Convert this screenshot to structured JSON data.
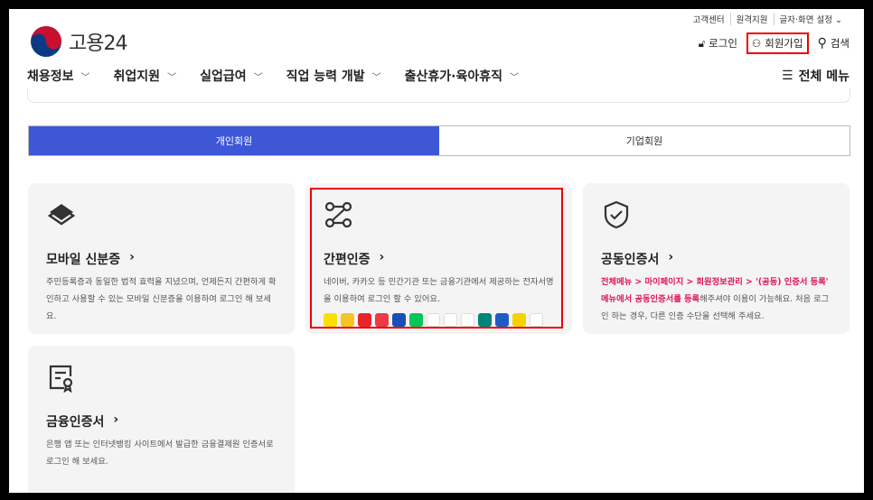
{
  "util_links": [
    "고객센터",
    "원격지원",
    "글자·화면 설정 ⌄"
  ],
  "logo": {
    "text": "고용24"
  },
  "actions": {
    "login": "로그인",
    "join": "회원가입",
    "search": "검색"
  },
  "gnb": [
    "채용정보",
    "취업지원",
    "실업급여",
    "직업 능력 개발",
    "출산휴가·육아휴직"
  ],
  "all_menu": "전체 메뉴",
  "tabs": {
    "personal": "개인회원",
    "corporate": "기업회원",
    "active": "개인회원"
  },
  "cards": {
    "mobile": {
      "title": "모바일 신분증",
      "desc": "주민등록증과 동일한 법적 효력을 지녔으며, 언제든지 간편하게 확인하고 사용할 수 있는 모바일 신분증을 이용하여 로그인 해 보세요."
    },
    "simple": {
      "title": "간편인증",
      "desc": "네이버, 카카오 등 민간기관 또는 금융기관에서 제공하는 전자서명을 이용하여 로그인 할 수 있어요."
    },
    "joint": {
      "title": "공동인증서",
      "desc_highlight": "전체메뉴 > 마이페이지 > 회원정보관리 > '(공동) 인증서 등록' 메뉴에서 공동인증서를 등록",
      "desc": "해주셔야 이용이 가능해요. 처음 로그인 하는 경우, 다른 인증 수단을 선택해 주세요."
    },
    "finance": {
      "title": "금융인증서",
      "desc": "은행 앱 또는 인터넷뱅킹 사이트에서 발급한 금융결제원 인증서로 로그인 해 보세요."
    }
  },
  "providers": [
    {
      "name": "kakao",
      "color": "#fae100"
    },
    {
      "name": "kb",
      "color": "#f7c325"
    },
    {
      "name": "payco",
      "color": "#e8232b"
    },
    {
      "name": "pass",
      "color": "#ed3a45"
    },
    {
      "name": "samsung-pass",
      "color": "#1a4fb5"
    },
    {
      "name": "naver",
      "color": "#03c75a"
    },
    {
      "name": "shinhan",
      "color": "#ffffff"
    },
    {
      "name": "toss",
      "color": "#ffffff"
    },
    {
      "name": "bank",
      "color": "#ffffff"
    },
    {
      "name": "hana",
      "color": "#00857a"
    },
    {
      "name": "nh",
      "color": "#1e5bc6"
    },
    {
      "name": "banksalad",
      "color": "#f6d300"
    },
    {
      "name": "woori",
      "color": "#ffffff"
    }
  ],
  "accent": "#3d57d6",
  "highlight": "#e0185a"
}
